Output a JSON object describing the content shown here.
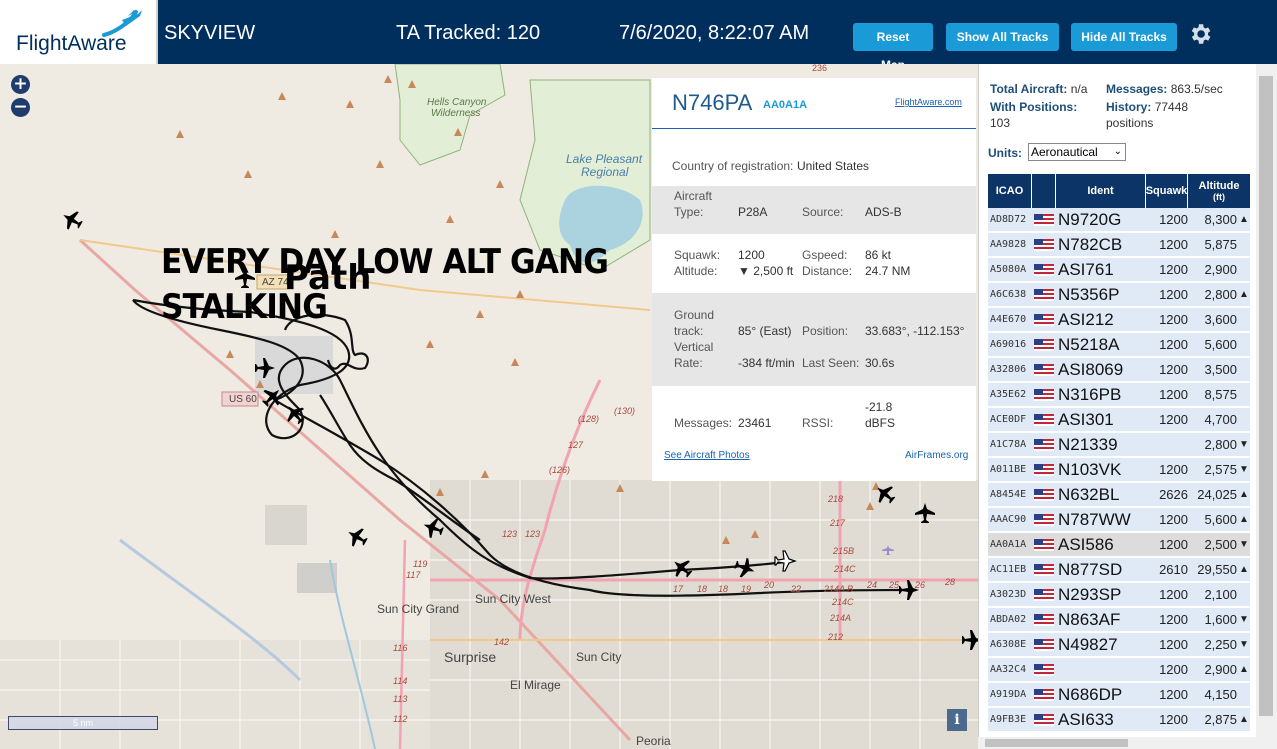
{
  "header": {
    "logo_text": "FlightAware",
    "app_name": "SKYVIEW",
    "tracked": "TA Tracked: 120",
    "datetime": "7/6/2020, 8:22:07 AM",
    "buttons": {
      "reset_map": "Reset Map",
      "show_all": "Show All Tracks",
      "hide_all": "Hide All Tracks"
    },
    "colors": {
      "bar": "#002f5d",
      "button": "#1a9bd7"
    }
  },
  "map": {
    "zoom_in": "+",
    "zoom_out": "−",
    "overlay_line1": "EVERY DAY LOW ALT GANG",
    "overlay_line2": "STALKING",
    "overlay_path": "Path",
    "scale": "5 nm",
    "info": "i",
    "labels": {
      "hells_canyon_1": "Hells Canyon",
      "hells_canyon_2": "Wilderness",
      "lake_1": "Lake Pleasant",
      "lake_2": "Regional",
      "az74": "AZ 74",
      "us60": "US 60",
      "sun_city_grand": "Sun City Grand",
      "sun_city_west": "Sun City West",
      "surprise": "Surprise",
      "sun_city": "Sun City",
      "el_mirage": "El Mirage",
      "peoria": "Peoria",
      "r236": "236",
      "r130": "(130)",
      "r128": "(128)",
      "r127": "127",
      "r126": "(126)",
      "r123": "123",
      "r123b": "123",
      "r119": "119",
      "r117": "117",
      "r142": "142",
      "r116": "116",
      "r114": "114",
      "r113": "113",
      "r112": "112",
      "r17": "17",
      "r18": "18",
      "r19": "19",
      "r20": "20",
      "r22": "22",
      "r24": "24",
      "r25": "25",
      "r26": "26",
      "r28": "28",
      "r218": "218",
      "r217": "217",
      "r215b": "215B",
      "r214c": "214C",
      "r214ab": "214A B",
      "r214c2": "214C",
      "r214a": "214A",
      "r212": "212"
    }
  },
  "popup": {
    "callsign": "N746PA",
    "hex": "AA0A1A",
    "flightaware_link": "FlightAware.com",
    "country_label": "Country of registration:",
    "country": "United States",
    "aircraft_type_label_1": "Aircraft",
    "aircraft_type_label_2": "Type:",
    "aircraft_type": "P28A",
    "source_label": "Source:",
    "source": "ADS-B",
    "squawk_label": "Squawk:",
    "squawk": "1200",
    "gspeed_label": "Gspeed:",
    "gspeed": "86 kt",
    "altitude_label": "Altitude:",
    "altitude": "▼ 2,500 ft",
    "distance_label": "Distance:",
    "distance": "24.7 NM",
    "track_label_1": "Ground",
    "track_label_2": "track:",
    "track": "85° (East)",
    "position_label": "Position:",
    "position": "33.683°, -112.153°",
    "vrate_label_1": "Vertical",
    "vrate_label_2": "Rate:",
    "vrate": "-384 ft/min",
    "lastseen_label": "Last Seen:",
    "lastseen": "30.6s",
    "messages_label": "Messages:",
    "messages": "23461",
    "rssi_label": "RSSI:",
    "rssi_1": "-21.8",
    "rssi_2": "dBFS",
    "photos_link": "See Aircraft Photos",
    "airframes_link": "AirFrames.org"
  },
  "panel": {
    "total_label": "Total Aircraft:",
    "total": "n/a",
    "messages_label": "Messages:",
    "messages": "863.5/sec",
    "positions_label": "With Positions:",
    "positions": "103",
    "history_label": "History:",
    "history": "77448",
    "history_unit": "positions",
    "units_label": "Units:",
    "units_value": "Aeronautical",
    "columns": {
      "icao": "ICAO",
      "ident": "Ident",
      "squawk": "Squawk",
      "altitude_1": "Altitude",
      "altitude_2": "(ft)"
    },
    "rows": [
      {
        "icao": "AD8D72",
        "ident": "N9720G",
        "squawk": "1200",
        "alt": "8,300",
        "trend": "▲"
      },
      {
        "icao": "AA9828",
        "ident": "N782CB",
        "squawk": "1200",
        "alt": "5,875",
        "trend": ""
      },
      {
        "icao": "A5080A",
        "ident": "ASI761",
        "squawk": "1200",
        "alt": "2,900",
        "trend": ""
      },
      {
        "icao": "A6C638",
        "ident": "N5356P",
        "squawk": "1200",
        "alt": "2,800",
        "trend": "▲"
      },
      {
        "icao": "A4E670",
        "ident": "ASI212",
        "squawk": "1200",
        "alt": "3,600",
        "trend": ""
      },
      {
        "icao": "A69016",
        "ident": "N5218A",
        "squawk": "1200",
        "alt": "5,600",
        "trend": ""
      },
      {
        "icao": "A32806",
        "ident": "ASI8069",
        "squawk": "1200",
        "alt": "3,500",
        "trend": ""
      },
      {
        "icao": "A35E62",
        "ident": "N316PB",
        "squawk": "1200",
        "alt": "8,575",
        "trend": ""
      },
      {
        "icao": "ACE0DF",
        "ident": "ASI301",
        "squawk": "1200",
        "alt": "4,700",
        "trend": ""
      },
      {
        "icao": "A1C78A",
        "ident": "N21339",
        "squawk": "",
        "alt": "2,800",
        "trend": "▼"
      },
      {
        "icao": "A011BE",
        "ident": "N103VK",
        "squawk": "1200",
        "alt": "2,575",
        "trend": "▼"
      },
      {
        "icao": "A8454E",
        "ident": "N632BL",
        "squawk": "2626",
        "alt": "24,025",
        "trend": "▲"
      },
      {
        "icao": "AAAC90",
        "ident": "N787WW",
        "squawk": "1200",
        "alt": "5,600",
        "trend": "▲"
      },
      {
        "icao": "AA0A1A",
        "ident": "ASI586",
        "squawk": "1200",
        "alt": "2,500",
        "trend": "▼"
      },
      {
        "icao": "AC11EB",
        "ident": "N877SD",
        "squawk": "2610",
        "alt": "29,550",
        "trend": "▲"
      },
      {
        "icao": "A3023D",
        "ident": "N293SP",
        "squawk": "1200",
        "alt": "2,100",
        "trend": ""
      },
      {
        "icao": "ABDA02",
        "ident": "N863AF",
        "squawk": "1200",
        "alt": "1,600",
        "trend": "▼"
      },
      {
        "icao": "A6308E",
        "ident": "N49827",
        "squawk": "1200",
        "alt": "2,250",
        "trend": "▼"
      },
      {
        "icao": "AA32C4",
        "ident": "",
        "squawk": "1200",
        "alt": "2,900",
        "trend": "▲"
      },
      {
        "icao": "A919DA",
        "ident": "N686DP",
        "squawk": "1200",
        "alt": "4,150",
        "trend": ""
      },
      {
        "icao": "A9FB3E",
        "ident": "ASI633",
        "squawk": "1200",
        "alt": "2,875",
        "trend": "▲"
      }
    ],
    "selected_icao": "AA0A1A",
    "colors": {
      "row": "#dfeaf6",
      "row_selected": "#dcdcdc",
      "table_header": "#0c3466"
    }
  }
}
